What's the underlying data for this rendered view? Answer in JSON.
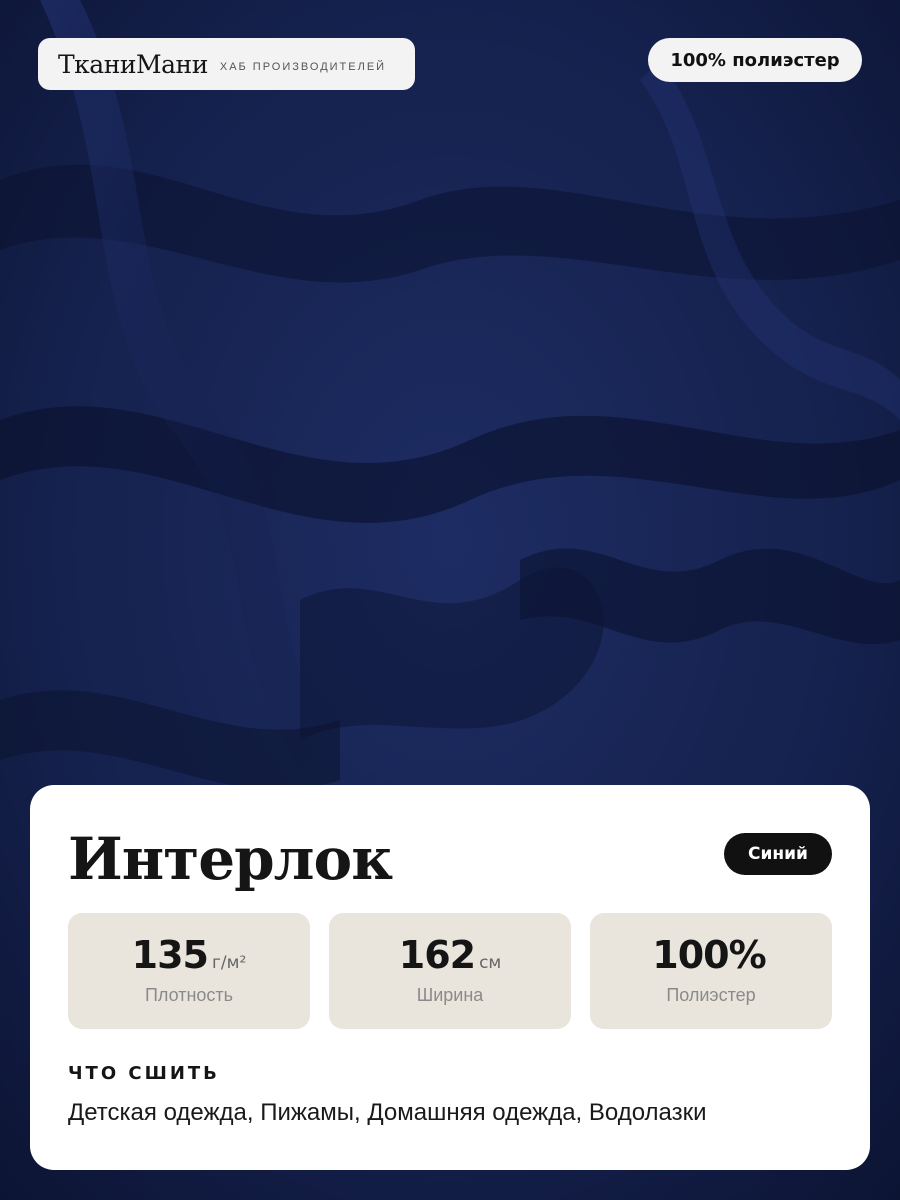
{
  "brand": {
    "name": "ТканиМани",
    "subtitle": "ХАБ ПРОИЗВОДИТЕЛЕЙ"
  },
  "material_badge": "100% полиэстер",
  "product": {
    "title": "Интерлок",
    "color_badge": "Синий"
  },
  "stats": [
    {
      "value": "135",
      "unit": "г/м²",
      "label": "Плотность"
    },
    {
      "value": "162",
      "unit": "см",
      "label": "Ширина"
    },
    {
      "value": "100%",
      "unit": "",
      "label": "Полиэстер"
    }
  ],
  "uses": {
    "heading": "ЧТО СШИТЬ",
    "text": "Детская одежда, Пижамы, Домашняя одежда, Водолазки"
  },
  "colors": {
    "fabric": "#142046",
    "card": "#ffffff",
    "stat_bg": "#e9e5dc",
    "badge": "#111111"
  }
}
